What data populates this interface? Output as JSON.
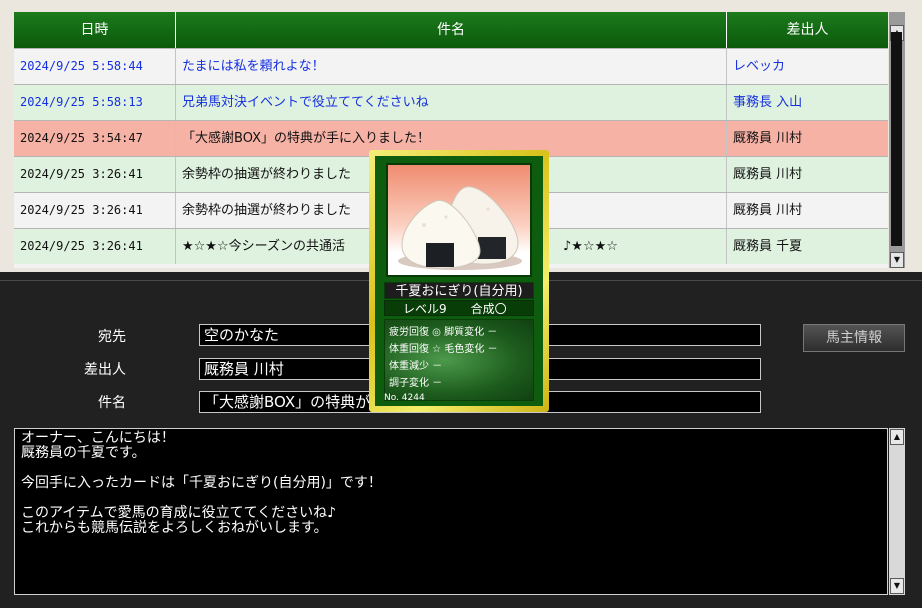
{
  "table": {
    "headers": [
      "日時",
      "件名",
      "差出人"
    ],
    "rows": [
      {
        "date": "2024/9/25 5:58:44",
        "subject": "たまには私を頼れよな！",
        "sender": "レベッカ",
        "state": "unread",
        "bg": "bg-white"
      },
      {
        "date": "2024/9/25 5:58:13",
        "subject": "兄弟馬対決イベントで役立ててくださいね",
        "sender": "事務長 入山",
        "state": "unread",
        "bg": "bg-green"
      },
      {
        "date": "2024/9/25 3:54:47",
        "subject": "「大感謝BOX」の特典が手に入りました！",
        "sender": "厩務員 川村",
        "state": "read",
        "bg": "bg-selected"
      },
      {
        "date": "2024/9/25 3:26:41",
        "subject": "余勢枠の抽選が終わりました",
        "sender": "厩務員 川村",
        "state": "read",
        "bg": "bg-green"
      },
      {
        "date": "2024/9/25 3:26:41",
        "subject": "余勢枠の抽選が終わりました",
        "sender": "厩務員 川村",
        "state": "read",
        "bg": "bg-white"
      },
      {
        "date": "2024/9/25 3:26:41",
        "subject": "★☆★☆今シーズンの共通活",
        "sender": "厩務員 千夏",
        "state": "read",
        "bg": "bg-green",
        "subject_tail": "♪★☆★☆"
      }
    ]
  },
  "detail": {
    "to_label": "宛先",
    "to_value": "空のかなた",
    "from_label": "差出人",
    "from_value": "厩務員 川村",
    "subject_label": "件名",
    "subject_value": "「大感謝BOX」の特典が",
    "owner_button": "馬主情報"
  },
  "body": {
    "lines": [
      "オーナー、こんにちは！",
      "厩務員の千夏です。",
      "",
      "今回手に入ったカードは「千夏おにぎり(自分用)」です！",
      "",
      "このアイテムで愛馬の育成に役立ててくださいね♪",
      "これからも競馬伝説をよろしくおねがいします。"
    ]
  },
  "card": {
    "name": "千夏おにぎり(自分用)",
    "level": "レベル9",
    "synth": "合成〇",
    "stats": [
      "疲労回復 ◎ 脚質変化 －",
      "体重回復 ☆ 毛色変化 －",
      "体重減少 －",
      "調子変化 －"
    ],
    "number": "No. 4244"
  },
  "icons": {
    "scroll_up": "scroll-up-arrow-icon",
    "scroll_down": "scroll-down-arrow-icon"
  },
  "colors": {
    "header_green": "#0b5a0b",
    "unread_text": "#1530e0",
    "selected_row": "#f7b2a6"
  }
}
